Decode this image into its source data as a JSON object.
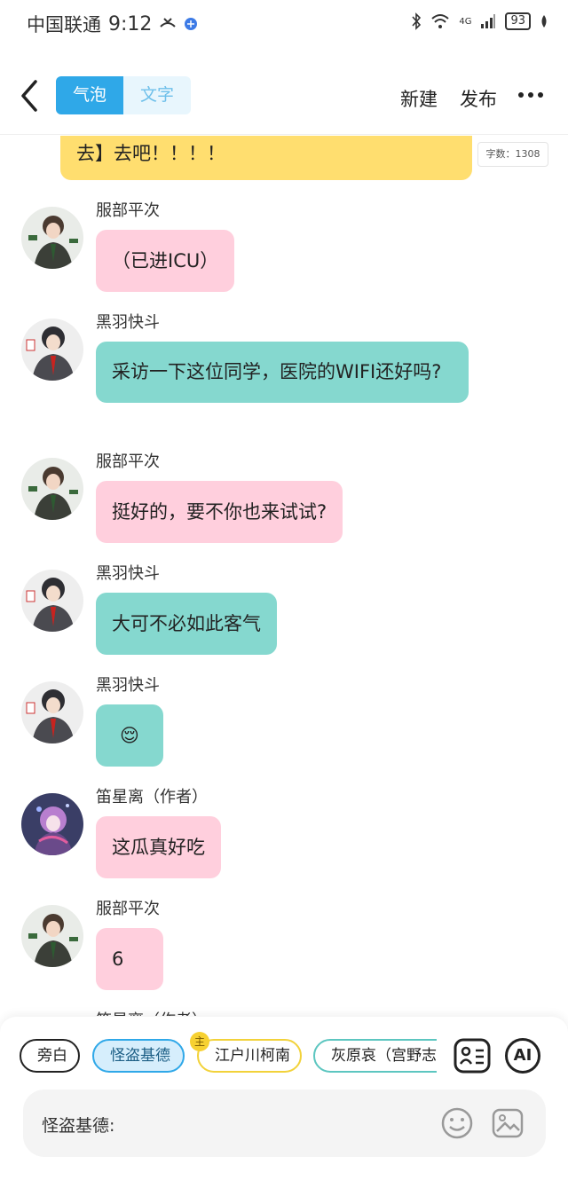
{
  "status_bar": {
    "carrier": "中国联通",
    "time": "9:12",
    "network": "4G",
    "battery": "93"
  },
  "header": {
    "tabs": [
      {
        "label": "气泡",
        "active": true
      },
      {
        "label": "文字",
        "active": false
      }
    ],
    "new_label": "新建",
    "publish_label": "发布"
  },
  "chat": {
    "top_bubble_text": "去】去吧！！！！",
    "word_count": "字数：1308",
    "messages": [
      {
        "speaker": "服部平次",
        "text": "（已进ICU）",
        "color": "#ffcfdd"
      },
      {
        "speaker": "黑羽快斗",
        "text": "采访一下这位同学，医院的WIFI还好吗?",
        "color": "#85d8cf"
      },
      {
        "speaker": "服部平次",
        "text": "挺好的，要不你也来试试?",
        "color": "#ffcfdd"
      },
      {
        "speaker": "黑羽快斗",
        "text": "大可不必如此客气",
        "color": "#85d8cf"
      },
      {
        "speaker": "黑羽快斗",
        "text": "😌",
        "color": "#85d8cf"
      },
      {
        "speaker": "笛星离（作者）",
        "text": "这瓜真好吃",
        "color": "#ffcfdd"
      },
      {
        "speaker": "服部平次",
        "text": "6",
        "color": "#ffcfdd"
      },
      {
        "speaker": "笛星离（作者）",
        "text": "",
        "color": "#ffcfdd"
      }
    ]
  },
  "composer": {
    "roles": [
      {
        "label": "旁白",
        "state": "aside"
      },
      {
        "label": "怪盗基德",
        "state": "selected"
      },
      {
        "label": "江户川柯南",
        "state": "main"
      },
      {
        "label": "灰原哀（宫野志保）",
        "state": "normal"
      }
    ],
    "main_badge": "主",
    "ai_label": "AI",
    "current_role_label": "怪盗基德:",
    "input_value": ""
  },
  "colors": {
    "accent": "#2fa8e8",
    "pink_bubble": "#ffcfdd",
    "teal_bubble": "#85d8cf",
    "yellow_bubble": "#ffde6f"
  }
}
